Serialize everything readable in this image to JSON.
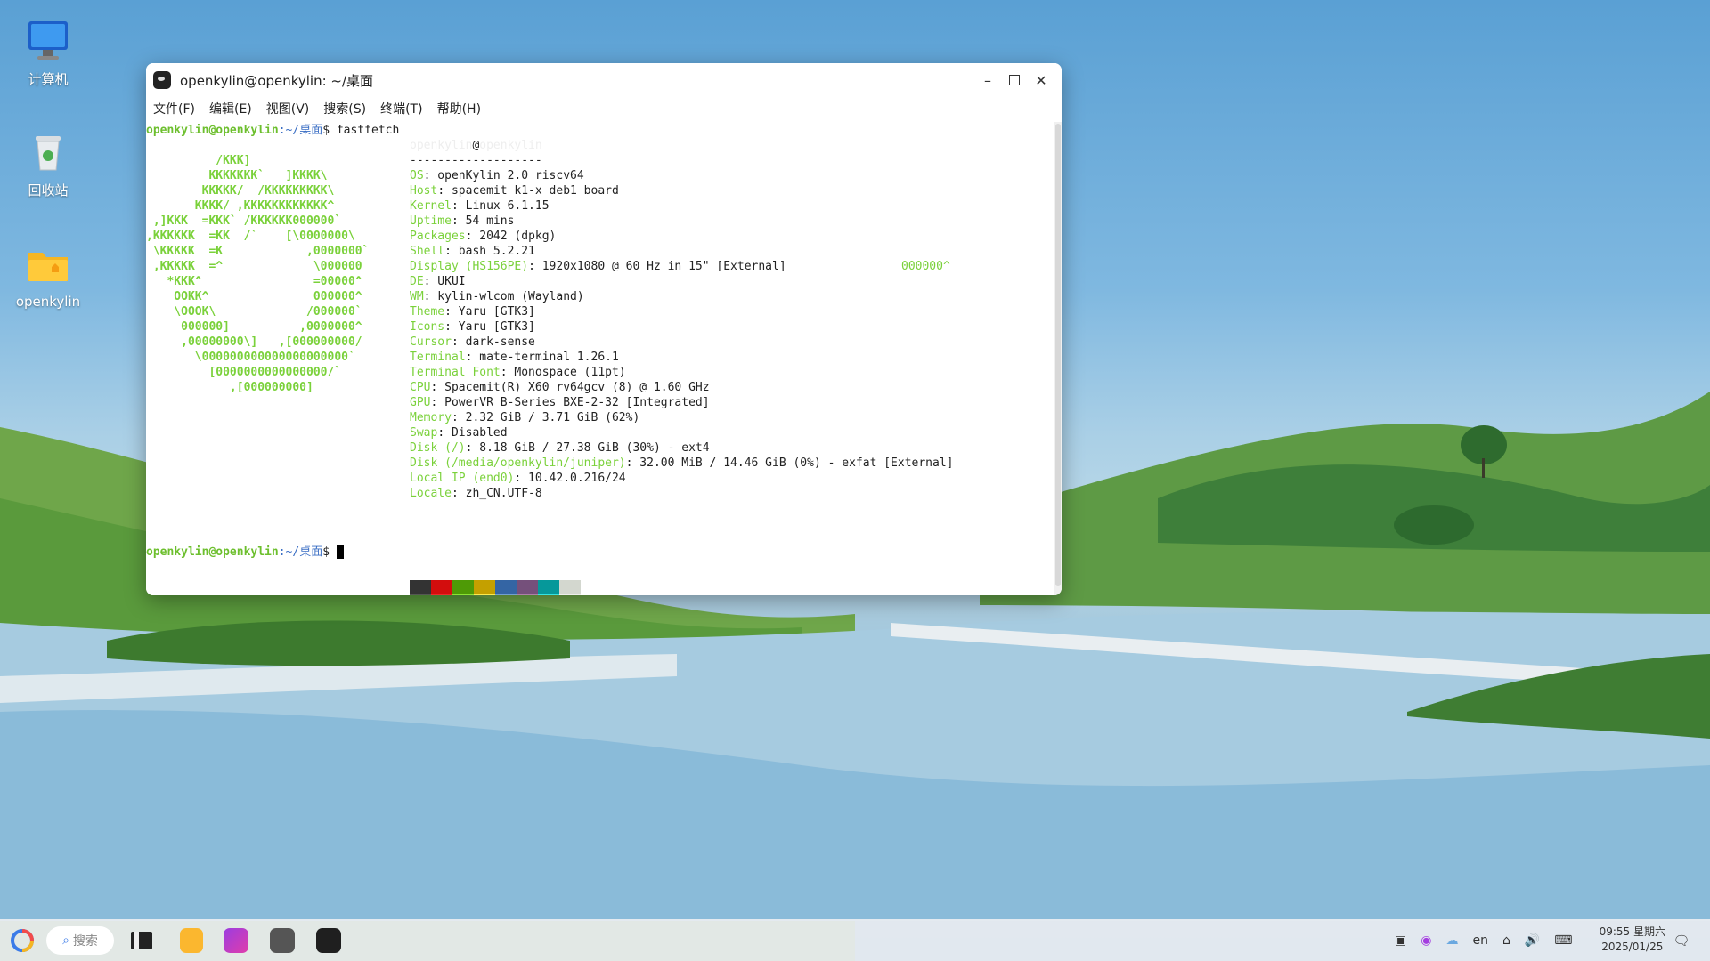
{
  "desktop": {
    "icons": [
      {
        "label": "计算机"
      },
      {
        "label": "回收站"
      },
      {
        "label": "openkylin"
      }
    ]
  },
  "window": {
    "title": "openkylin@openkylin: ~/桌面",
    "menu": [
      "文件(F)",
      "编辑(E)",
      "视图(V)",
      "搜索(S)",
      "终端(T)",
      "帮助(H)"
    ]
  },
  "terminal": {
    "prompt_user": "openkylin@openkylin",
    "prompt_path": ":~/桌面",
    "prompt_sign": "$",
    "command": " fastfetch",
    "header_user": "openkylin",
    "header_at": "@",
    "header_host": "openkylin",
    "separator": "-------------------",
    "logo": [
      "          /KKK]",
      "         KKKKKKK`   ]KKKK\\",
      "        KKKKK/  /KKKKKKKKK\\",
      "       KKKK/ ,KKKKKKKKKKKK^",
      " ,]KKK  =KKK` /KKKKKK000000`",
      ",KKKKKK  =KK  /`    [\\0000000\\",
      " \\KKKKK  =K            ,0000000`",
      " ,KKKKK  =^             \\000000",
      "   *KKK^                =00000^",
      "    OOKK^               000000^",
      "    \\OOOK\\             /000000`",
      "     000000]          ,0000000^",
      "     ,00000000\\]   ,[000000000/",
      "       \\000000000000000000000`",
      "         [0000000000000000/`",
      "            ,[000000000]"
    ],
    "info": [
      {
        "k": "OS",
        "v": ": openKylin 2.0 riscv64"
      },
      {
        "k": "Host",
        "v": ": spacemit k1-x deb1 board"
      },
      {
        "k": "Kernel",
        "v": ": Linux 6.1.15"
      },
      {
        "k": "Uptime",
        "v": ": 54 mins"
      },
      {
        "k": "Packages",
        "v": ": 2042 (dpkg)"
      },
      {
        "k": "Shell",
        "v": ": bash 5.2.21"
      },
      {
        "k": "Display (HS156PE)",
        "v": ": 1920x1080 @ 60 Hz in 15\" [External]"
      },
      {
        "k": "DE",
        "v": ": UKUI"
      },
      {
        "k": "WM",
        "v": ": kylin-wlcom (Wayland)"
      },
      {
        "k": "Theme",
        "v": ": Yaru [GTK3]"
      },
      {
        "k": "Icons",
        "v": ": Yaru [GTK3]"
      },
      {
        "k": "Cursor",
        "v": ": dark-sense"
      },
      {
        "k": "Terminal",
        "v": ": mate-terminal 1.26.1"
      },
      {
        "k": "Terminal Font",
        "v": ": Monospace (11pt)"
      },
      {
        "k": "CPU",
        "v": ": Spacemit(R) X60 rv64gcv (8) @ 1.60 GHz"
      },
      {
        "k": "GPU",
        "v": ": PowerVR B-Series BXE-2-32 [Integrated]"
      },
      {
        "k": "Memory",
        "v": ": 2.32 GiB / 3.71 GiB (62%)"
      },
      {
        "k": "Swap",
        "v": ": Disabled"
      },
      {
        "k": "Disk (/)",
        "v": ": 8.18 GiB / 27.38 GiB (30%) - ext4"
      },
      {
        "k": "Disk (/media/openkylin/juniper)",
        "v": ": 32.00 MiB / 14.46 GiB (0%) - exfat [External]"
      },
      {
        "k": "Local IP (end0)",
        "v": ": 10.42.0.216/24"
      },
      {
        "k": "Locale",
        "v": ": zh_CN.UTF-8"
      }
    ],
    "stray_text": "000000^",
    "palette_top": [
      "#333333",
      "#d30d0d",
      "#4e9a06",
      "#c4a000",
      "#3465a4",
      "#75507b",
      "#06989a",
      "#d3d7cf"
    ],
    "palette_bottom": [
      "#555753",
      "#ef2929",
      "#8ae234",
      "#fce94f",
      "#729fcf",
      "#ad7fa8",
      "#34e2e2",
      "#eeeeec"
    ]
  },
  "taskbar": {
    "search_placeholder": "搜索",
    "lang": "en",
    "time": "09:55 星期六",
    "date": "2025/01/25"
  }
}
